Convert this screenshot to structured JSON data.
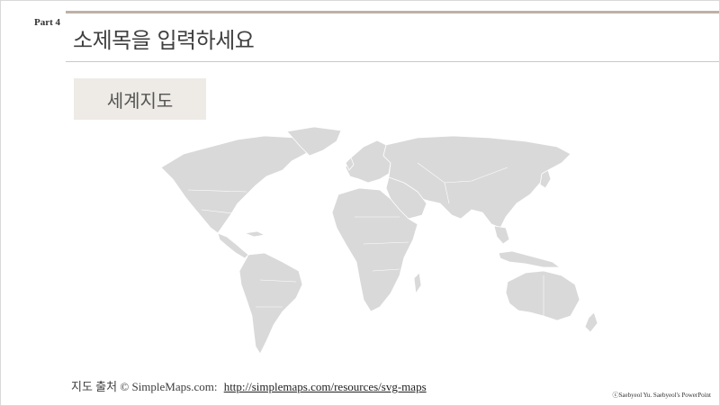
{
  "header": {
    "part_label": "Part 4",
    "title": "소제목을 입력하세요"
  },
  "section": {
    "label": "세계지도"
  },
  "map": {
    "fill_color": "#d9d9d9",
    "border_color": "#ffffff"
  },
  "footer": {
    "source_prefix": "지도 출처 © SimpleMaps.com:",
    "source_link": "http://simplemaps.com/resources/svg-maps",
    "copyright": "ⓒSaebyeol Yu. Saebyeol's PowerPoint"
  }
}
